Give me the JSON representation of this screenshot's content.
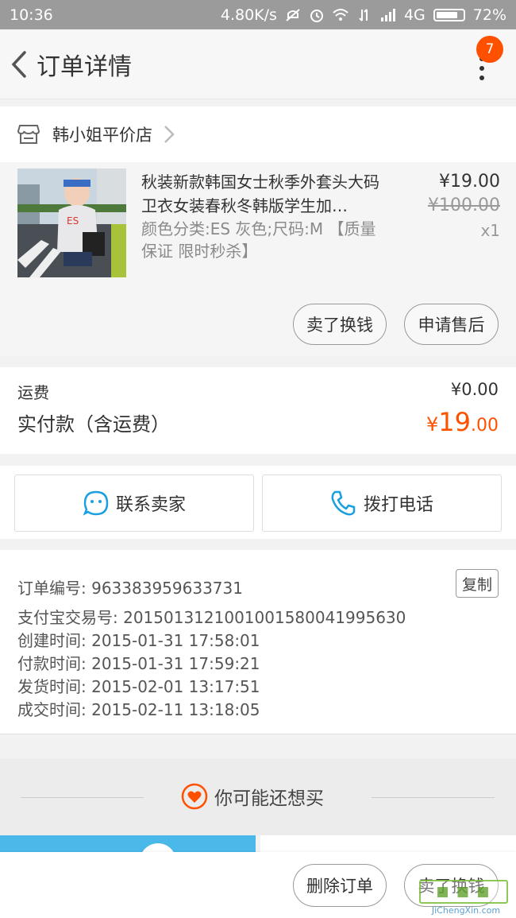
{
  "status_bar": {
    "time": "10:36",
    "speed": "4.80K/s",
    "network": "4G",
    "battery": "72%"
  },
  "header": {
    "title": "订单详情",
    "badge_count": "7"
  },
  "shop": {
    "name": "韩小姐平价店"
  },
  "product": {
    "title": "秋装新款韩国女士秋季外套头大码卫衣女装春秋冬韩版学生加…",
    "sku": "颜色分类:ES 灰色;尺码:M 【质量保证 限时秒杀】",
    "price": "¥19.00",
    "original_price": "¥100.00",
    "quantity": "x1",
    "actions": [
      "卖了换钱",
      "申请售后"
    ]
  },
  "totals": {
    "shipping_label": "运费",
    "shipping_value": "¥0.00",
    "paid_label": "实付款（含运费）",
    "paid_currency": "¥",
    "paid_integer": "19",
    "paid_decimal": ".00"
  },
  "contact": {
    "seller_label": "联系卖家",
    "phone_label": "拨打电话"
  },
  "order_info": {
    "order_no": "订单编号: 963383959633731",
    "alipay_no": "支付宝交易号: 2015013121001001580041995630",
    "created": "创建时间: 2015-01-31 17:58:01",
    "paid": "付款时间: 2015-01-31 17:59:21",
    "shipped": "发货时间: 2015-02-01 13:17:51",
    "completed": "成交时间: 2015-02-11 13:18:05",
    "copy_label": "复制"
  },
  "recommend": {
    "title": "你可能还想买"
  },
  "bottom_bar": {
    "delete_label": "删除订单",
    "sell_label": "卖了换钱"
  },
  "watermark": {
    "text": "JiChengXin.com"
  },
  "colors": {
    "accent": "#ff5000",
    "contact_blue": "#1aa0e0",
    "watermark_green": "#7bbf3a"
  }
}
